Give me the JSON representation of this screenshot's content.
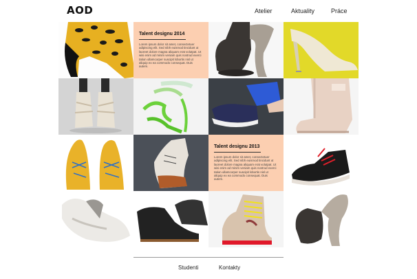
{
  "brand": {
    "logo": "AOD"
  },
  "nav": {
    "items": [
      "Atelier",
      "Aktuality",
      "Práce"
    ]
  },
  "text_tiles": [
    {
      "title": "Talent designu 2014",
      "body": "Lorem ipsum dolor sit amet, consectetuer adipiscing elit. Sed nibh euismod tincidunt ut laoreet dolore magna aliquam erat volutpat. Ut wisi enim ad minim veniam quis nostrud exerci tation ullamcorper suscipit lobortis nisl ut aliquip ex ea commodo consequat. Duis autem."
    },
    {
      "title": "Talent designu 2013",
      "body": "Lorem ipsum dolor sit amet, consectetuer adipiscing elit. Sed nibh euismod tincidunt ut laoreet dolore magna aliquam erat volutpat. Ut wisi enim ad minim veniam quis nostrud exerci tation ullamcorper suscipit lobortis nisl ut aliquip ex ea commodo consequat. Duis autem."
    }
  ],
  "footer": {
    "items": [
      "Studenti",
      "Kontakty"
    ]
  },
  "colors": {
    "peach": "#fccfb1",
    "yellow": "#e5d82a",
    "text": "#222222"
  }
}
